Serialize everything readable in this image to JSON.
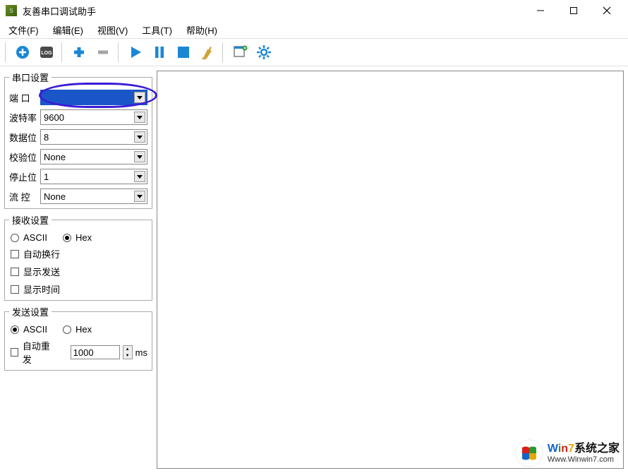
{
  "title": "友善串口调试助手",
  "menus": {
    "file": "文件(F)",
    "edit": "编辑(E)",
    "view": "视图(V)",
    "tools": "工具(T)",
    "help": "帮助(H)"
  },
  "serial": {
    "legend": "串口设置",
    "port_label": "端  口",
    "port_value": "",
    "baud_label": "波特率",
    "baud_value": "9600",
    "data_label": "数据位",
    "data_value": "8",
    "parity_label": "校验位",
    "parity_value": "None",
    "stop_label": "停止位",
    "stop_value": "1",
    "flow_label": "流  控",
    "flow_value": "None"
  },
  "recv": {
    "legend": "接收设置",
    "ascii": "ASCII",
    "hex": "Hex",
    "mode": "hex",
    "wrap": "自动换行",
    "show_send": "显示发送",
    "show_time": "显示时间"
  },
  "send": {
    "legend": "发送设置",
    "ascii": "ASCII",
    "hex": "Hex",
    "mode": "ascii",
    "auto_repeat": "自动重发",
    "interval": "1000",
    "unit": "ms"
  },
  "watermark": {
    "brand": "Win7",
    "suffix": "系统之家",
    "url": "Www.Winwin7.com"
  }
}
